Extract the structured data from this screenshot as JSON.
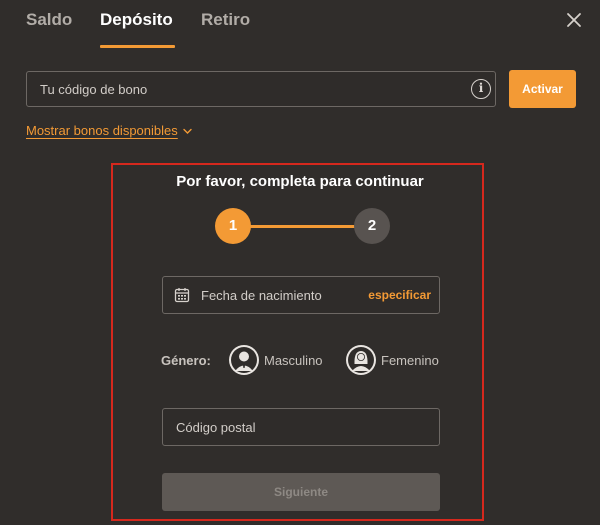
{
  "tabs": [
    {
      "label": "Saldo",
      "active": false
    },
    {
      "label": "Depósito",
      "active": true
    },
    {
      "label": "Retiro",
      "active": false
    }
  ],
  "close_icon": "close-icon",
  "bonus": {
    "placeholder": "Tu código de bono",
    "info_icon_glyph": "i",
    "activate_label": "Activar",
    "show_available_label": "Mostrar bonos disponibles"
  },
  "form": {
    "title": "Por favor, completa para continuar",
    "steps": [
      "1",
      "2"
    ],
    "current_step": 1,
    "dob_label": "Fecha de nacimiento",
    "dob_action": "especificar",
    "gender_label": "Género:",
    "gender_options": [
      "Masculino",
      "Femenino"
    ],
    "postal_placeholder": "Código postal",
    "next_label": "Siguiente"
  },
  "colors": {
    "background": "#302d2b",
    "accent": "#f39a35",
    "highlight_frame": "#d5281d",
    "disabled_button": "#5e5955"
  }
}
